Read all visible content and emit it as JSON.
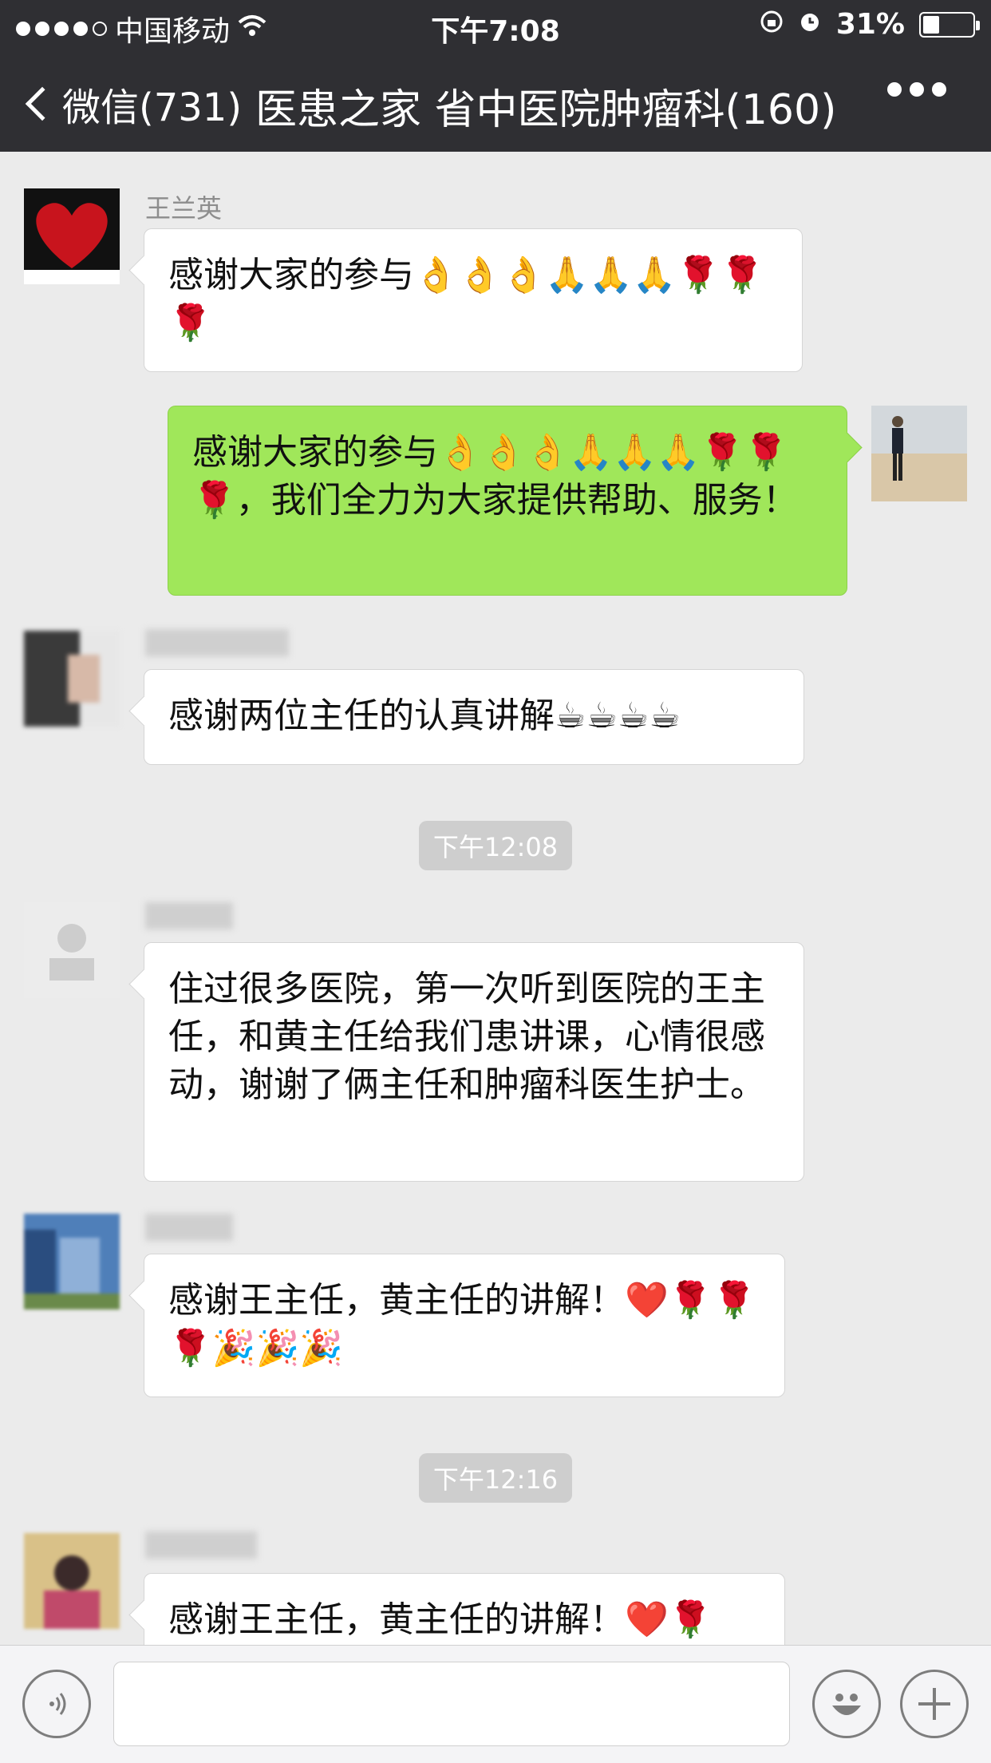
{
  "status_bar": {
    "carrier": "中国移动",
    "time": "下午7:08",
    "battery": "31%",
    "battery_level": 0.31
  },
  "nav": {
    "back_label": "微信(731)",
    "title": "医患之家 省中医院肿瘤科(160)"
  },
  "messages": [
    {
      "sender": "王兰英",
      "text": "感谢大家的参与👌👌👌🙏🙏🙏🌹🌹🌹",
      "mine": false
    },
    {
      "sender": "",
      "text": "感谢大家的参与👌👌👌🙏🙏🙏🌹🌹🌹，我们全力为大家提供帮助、服务！",
      "mine": true
    },
    {
      "sender": "",
      "text": "感谢两位主任的认真讲解☕☕☕☕",
      "mine": false
    },
    {
      "sender": "",
      "text": "住过很多医院，第一次听到医院的王主任，和黄主任给我们患讲课，心情很感动，谢谢了俩主任和肿瘤科医生护士。",
      "mine": false
    },
    {
      "sender": "",
      "text": "感谢王主任，黄主任的讲解！❤️🌹🌹🌹🎉🎉🎉",
      "mine": false
    },
    {
      "sender": "",
      "text": "感谢王主任，黄主任的讲解！❤️🌹",
      "mine": false
    }
  ],
  "timestamps": [
    "下午12:08",
    "下午12:16"
  ],
  "icons": {
    "back": "chevron-left-icon",
    "more": "more-icon",
    "voice": "voice-icon",
    "emoji": "emoji-icon",
    "plus": "plus-icon"
  },
  "colors": {
    "nav_bg": "#2f2f33",
    "chat_bg": "#ebebeb",
    "mine_bubble": "#a0e75a",
    "other_bubble": "#ffffff"
  }
}
